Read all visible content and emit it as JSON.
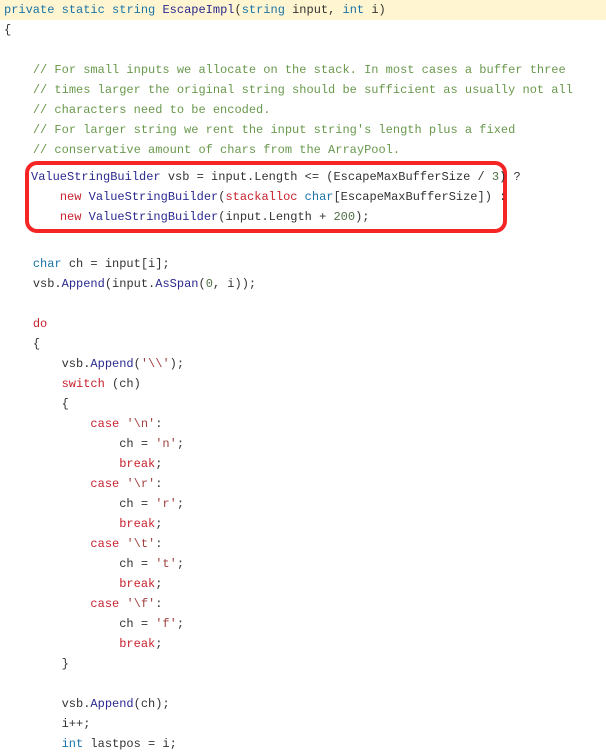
{
  "header": {
    "kw_private": "private",
    "kw_static": "static",
    "kw_string": "string",
    "method_name": "EscapeImpl",
    "param1_type": "string",
    "param1_name": "input",
    "kw_int": "int",
    "param2_name": "i"
  },
  "braces": {
    "open": "{",
    "close": "}"
  },
  "comments": {
    "c1": "// For small inputs we allocate on the stack. In most cases a buffer three",
    "c2": "// times larger the original string should be sufficient as usually not all",
    "c3": "// characters need to be encoded.",
    "c4": "// For larger string we rent the input string's length plus a fixed",
    "c5": "// conservative amount of chars from the ArrayPool."
  },
  "hl": {
    "type": "ValueStringBuilder",
    "var": "vsb",
    "eq": " = ",
    "expr1a": "input.Length <= (EscapeMaxBufferSize / ",
    "num_three": "3",
    "expr1b": ") ?",
    "kw_new": "new",
    "ctor": "ValueStringBuilder",
    "stackalloc": "stackalloc",
    "kw_char": "char",
    "bufsz": "[EscapeMaxBufferSize]) :",
    "line3a": "(input.Length + ",
    "num_200": "200",
    "line3b": ");"
  },
  "body": {
    "char_kw": "char",
    "ch_decl": " ch = input[i];",
    "append_span_a": "vsb.",
    "append": "Append",
    "append_span_b": "(input.",
    "asspan": "AsSpan",
    "append_span_c": "(",
    "num_zero": "0",
    "append_span_d": ", i));",
    "do_kw": "do",
    "append_bs_a": "vsb.",
    "append_bs_c": "(",
    "bs_str": "'\\\\'",
    "append_bs_d": ");",
    "switch_kw": "switch",
    "switch_expr": " (ch)",
    "case_kw": "case",
    "case_n": "'\\n'",
    "ch_assign": "ch = ",
    "val_n": "'n'",
    "semicolon": ";",
    "break_kw": "break",
    "case_r": "'\\r'",
    "val_r": "'r'",
    "case_t": "'\\t'",
    "val_t": "'t'",
    "case_f": "'\\f'",
    "val_f": "'f'",
    "append_ch_a": "vsb.",
    "append_ch_c": "(ch);",
    "ipp": "i++;",
    "int_kw": "int",
    "lastpos": " lastpos = i;"
  }
}
